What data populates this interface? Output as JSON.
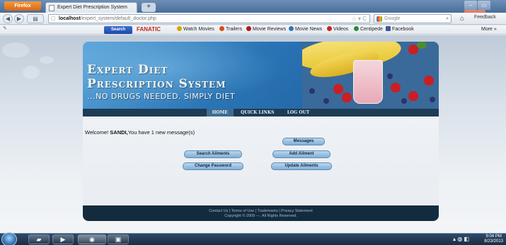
{
  "browser": {
    "app_button": "Firefox",
    "tab_title": "Expert Diet Prescription System",
    "new_tab": "+",
    "url_host": "localhost",
    "url_path": "/expert_system/default_doctor.php",
    "search_placeholder": "Google",
    "feedback": "Feedback",
    "window_controls": [
      "–",
      "▭",
      "✕"
    ]
  },
  "toolbar": {
    "search_label": "Search",
    "fanatic_label": "FANATIC",
    "items": [
      {
        "label": "Watch Movies",
        "color": "#d9a400"
      },
      {
        "label": "Trailers",
        "color": "#d94b1a"
      },
      {
        "label": "Movie Reviews",
        "color": "#b01818"
      },
      {
        "label": "Movie News",
        "color": "#2f74c0"
      },
      {
        "label": "Videos",
        "color": "#cc2222"
      },
      {
        "label": "Centipede",
        "color": "#2b8a3a"
      },
      {
        "label": "Facebook",
        "color": "#3b5998"
      }
    ],
    "more": "More"
  },
  "site": {
    "logo_line1": "Expert Diet",
    "logo_line2": "Prescription System",
    "logo_tagline": "...NO DRUGS NEEDED. SIMPLY DIET",
    "menu": [
      "HOME",
      "QUICK LINKS",
      "LOG OUT"
    ],
    "welcome_prefix": "Welcome! ",
    "username": "SANDI,",
    "welcome_suffix": "You have  1 new message(s)",
    "buttons": {
      "messages": "Messages",
      "search_ailments": "Search Ailments",
      "add_ailment": "Add Ailment",
      "change_password": "Change Password",
      "update_ailments": "Update Ailments"
    },
    "footer_links": "Contact Us | Terms of Use | Trademarks | Privacy Statement",
    "footer_copyright": "Copyright © 2009 ---. All Rights Reserved."
  },
  "taskbar": {
    "time": "9:04 PM",
    "date": "8/23/2013"
  }
}
